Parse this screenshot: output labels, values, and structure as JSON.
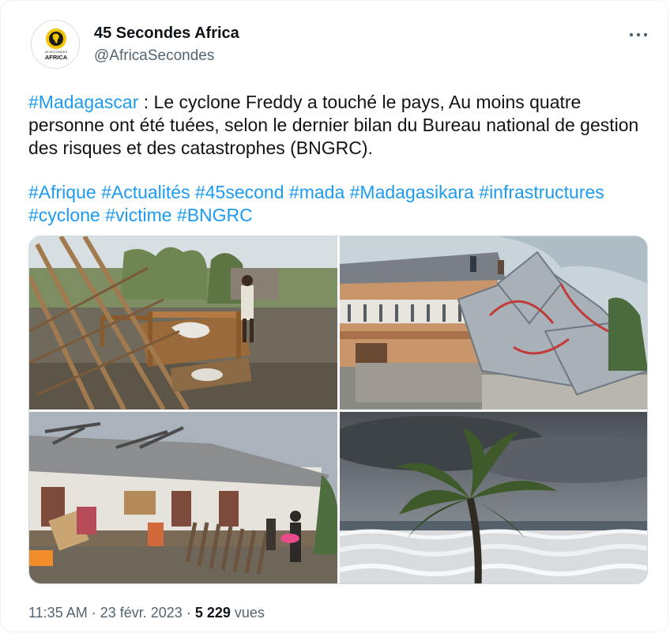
{
  "author": {
    "name": "45 Secondes Africa",
    "handle": "@AfricaSecondes",
    "avatar_logo_text": "AFRICA",
    "avatar_small_text": "45 SECONDES"
  },
  "more_icon": "more-horizontal-icon",
  "tweet": {
    "line1": [
      {
        "text": "#Madagascar",
        "tag": true
      },
      {
        "text": " : Le cyclone Freddy a touché le pays, Au moins quatre personne ont été tuées, selon le dernier bilan du Bureau national de gestion des risques et des catastrophes (BNGRC).",
        "tag": false
      }
    ],
    "hashtags": [
      "#Afrique",
      "#Actualités",
      "#45second",
      "#mada",
      "#Madagasikara",
      "#infrastructures",
      "#cyclone",
      "#victime",
      "#BNGRC"
    ]
  },
  "meta": {
    "time": "11:35 AM",
    "sep": " · ",
    "date": "23 févr. 2023",
    "views_count": "5 229",
    "views_label": "vues"
  },
  "colors": {
    "link": "#1d9bf0",
    "muted": "#536471",
    "text": "#0f1419",
    "logo_yellow": "#f2c300"
  }
}
